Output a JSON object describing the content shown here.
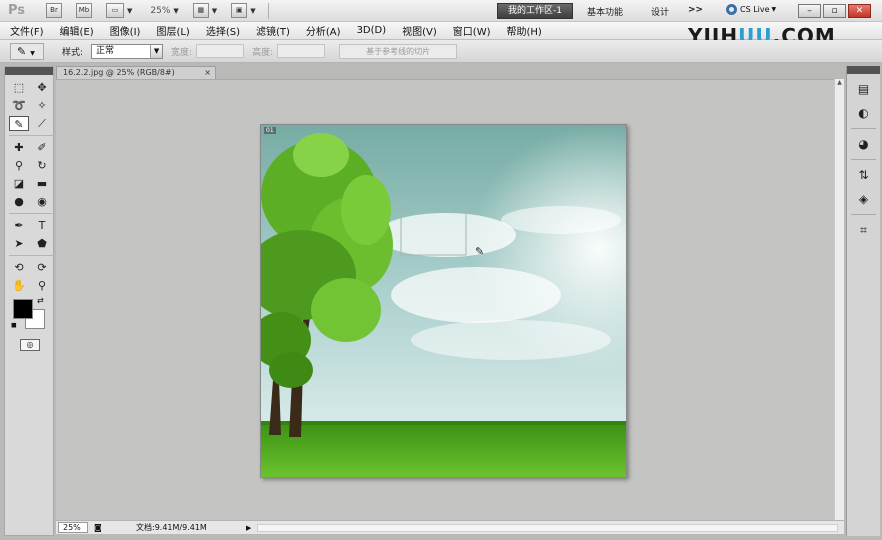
{
  "app": {
    "logo_text": "Ps",
    "bridge_label": "Br",
    "minibridge_label": "Mb",
    "zoom_level": "25%",
    "workspace_active": "我的工作区-1",
    "workspace_basic": "基本功能",
    "workspace_design": "设计",
    "more_label": ">>",
    "cslive_label": "CS Live",
    "window_controls": [
      "–",
      "▫",
      "✕"
    ]
  },
  "menu": {
    "items": [
      "文件(F)",
      "编辑(E)",
      "图像(I)",
      "图层(L)",
      "选择(S)",
      "滤镜(T)",
      "分析(A)",
      "3D(D)",
      "视图(V)",
      "窗口(W)",
      "帮助(H)"
    ]
  },
  "watermark": {
    "part1": "YIIH",
    "part2": "UU",
    "part3": ".COM"
  },
  "options": {
    "style_label": "样式:",
    "style_value": "正常",
    "width_label": "宽度:",
    "height_label": "高度:",
    "guide_slices_label": "基于参考线的切片"
  },
  "document": {
    "tab_title": "16.2.2.jpg @ 25% (RGB/8#)",
    "tab_close": "×",
    "slice_number": "01",
    "zoom": "25%",
    "doc_info": "文档:9.41M/9.41M"
  },
  "tools": {
    "icons": [
      "marquee-icon",
      "move-icon",
      "lasso-icon",
      "quick-select-icon",
      "slice-icon",
      "eyedropper-icon",
      "healing-icon",
      "brush-icon",
      "clone-stamp-icon",
      "history-brush-icon",
      "eraser-icon",
      "gradient-icon",
      "blur-icon",
      "dodge-icon",
      "pen-icon",
      "type-icon",
      "path-select-icon",
      "shape-icon",
      "3d-rotate-icon",
      "3d-orbit-icon",
      "hand-icon",
      "zoom-icon"
    ]
  },
  "dock": {
    "icons": [
      "histogram-icon",
      "navigator-icon",
      "color-icon",
      "adjustments-icon",
      "layers-icon",
      "crop-icon"
    ]
  },
  "colors": {
    "foreground": "#000000",
    "background": "#ffffff",
    "sky_top": "#7fb3ab",
    "grass": "#4aa11f"
  }
}
